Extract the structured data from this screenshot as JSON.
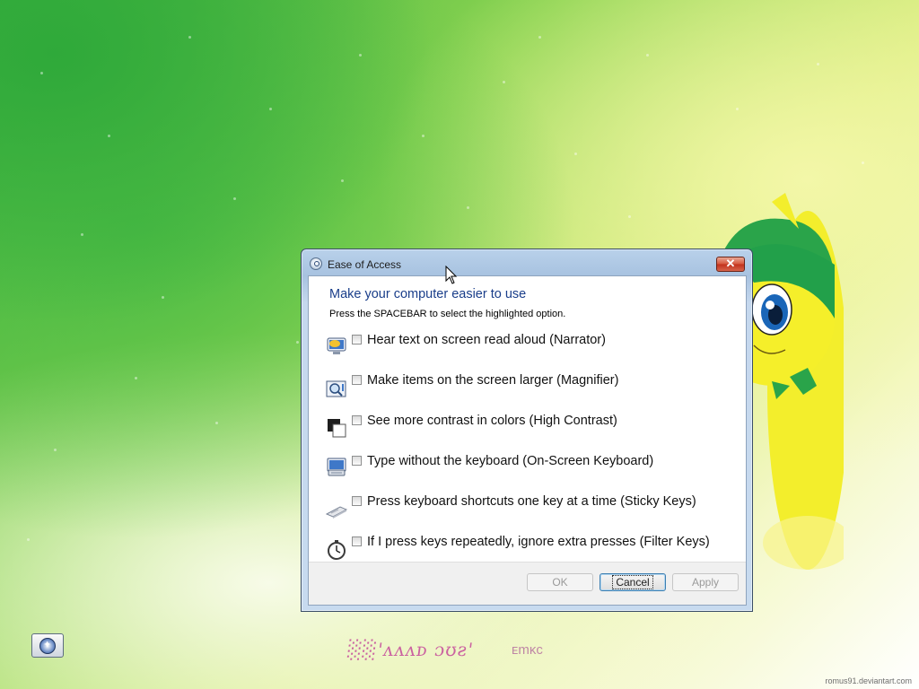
{
  "dialog": {
    "title": "Ease of Access",
    "close_glyph": "✕",
    "heading": "Make your computer easier to use",
    "instruction": "Press the SPACEBAR to select the highlighted option.",
    "options": [
      {
        "label": "Hear text on screen read aloud (Narrator)",
        "icon": "narrator-icon",
        "checked": false
      },
      {
        "label": "Make items on the screen larger (Magnifier)",
        "icon": "magnifier-icon",
        "checked": false
      },
      {
        "label": "See more contrast in colors (High Contrast)",
        "icon": "high-contrast-icon",
        "checked": false
      },
      {
        "label": "Type without the keyboard (On-Screen Keyboard)",
        "icon": "on-screen-keyboard-icon",
        "checked": false
      },
      {
        "label": "Press keyboard shortcuts one key at a time (Sticky Keys)",
        "icon": "sticky-keys-icon",
        "checked": false
      },
      {
        "label": "If I press keys repeatedly, ignore extra presses (Filter Keys)",
        "icon": "filter-keys-icon",
        "checked": false
      }
    ],
    "buttons": {
      "ok": "OK",
      "cancel": "Cancel",
      "apply": "Apply"
    }
  },
  "desktop": {
    "brand_text": "░░'ʌʌʌᴅ ɔʊƨ'",
    "brand_sub": "ᴇmᴋᴄ",
    "credit": "romus91.deviantart.com"
  },
  "colors": {
    "heading": "#1a3e8a",
    "close_button": "#c1301b",
    "background_green": "#34ad3c",
    "background_yellow": "#f4f8c8"
  }
}
